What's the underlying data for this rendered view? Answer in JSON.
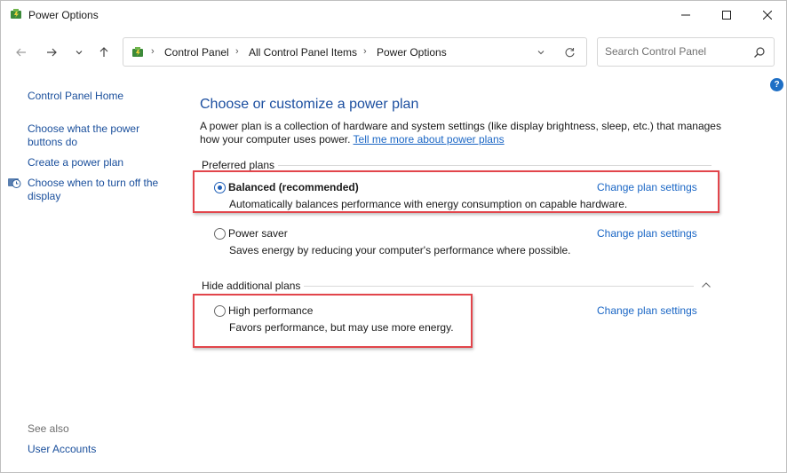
{
  "window": {
    "title": "Power Options"
  },
  "breadcrumb": [
    "Control Panel",
    "All Control Panel Items",
    "Power Options"
  ],
  "search": {
    "placeholder": "Search Control Panel"
  },
  "sidebar": {
    "home": "Control Panel Home",
    "links": [
      "Choose what the power buttons do",
      "Create a power plan",
      "Choose when to turn off the display"
    ],
    "see_also_label": "See also",
    "see_also": [
      "User Accounts"
    ]
  },
  "main": {
    "title": "Choose or customize a power plan",
    "description": "A power plan is a collection of hardware and system settings (like display brightness, sleep, etc.) that manages how your computer uses power.",
    "learn_more": "Tell me more about power plans",
    "preferred_label": "Preferred plans",
    "additional_label": "Hide additional plans",
    "change_label": "Change plan settings",
    "plans": [
      {
        "name": "Balanced (recommended)",
        "description": "Automatically balances performance with energy consumption on capable hardware.",
        "selected": true
      },
      {
        "name": "Power saver",
        "description": "Saves energy by reducing your computer's performance where possible.",
        "selected": false
      },
      {
        "name": "High performance",
        "description": "Favors performance, but may use more energy.",
        "selected": false
      }
    ]
  },
  "colors": {
    "link": "#1a66c5",
    "title": "#1c4fa0",
    "highlight": "#e2454b"
  }
}
